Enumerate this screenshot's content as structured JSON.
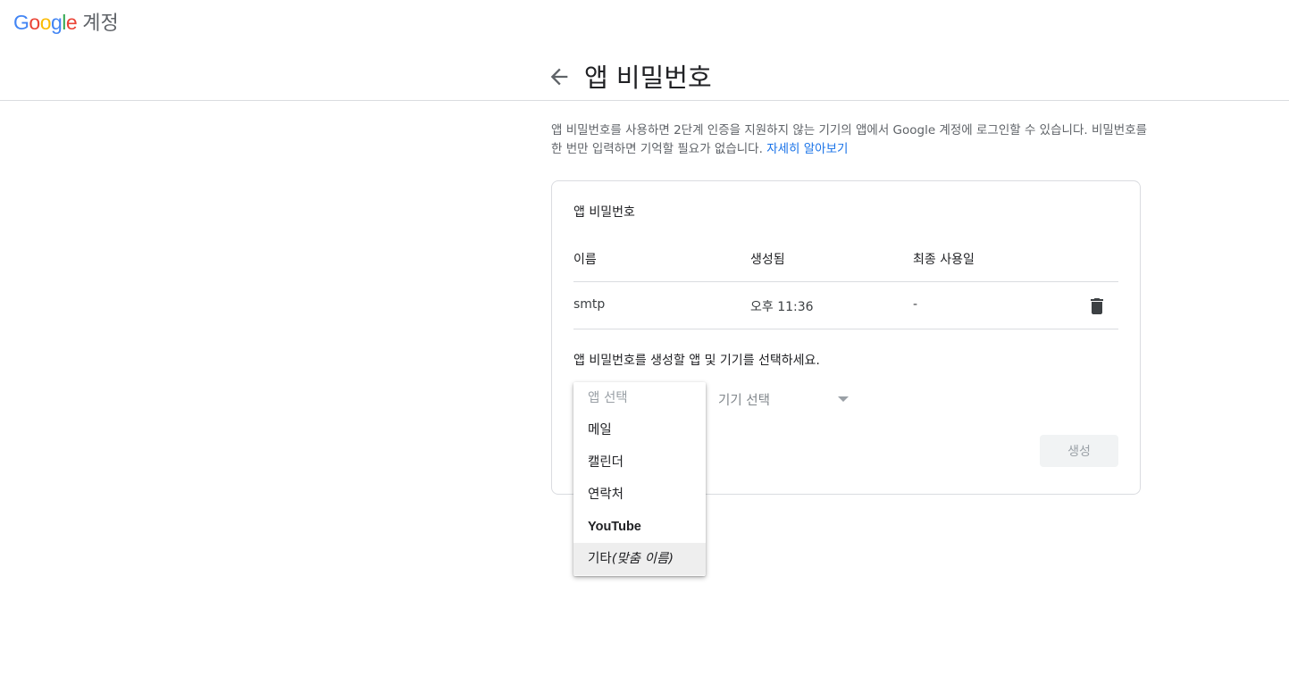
{
  "brand": {
    "logo_letters": [
      {
        "ch": "G",
        "color": "#4285F4"
      },
      {
        "ch": "o",
        "color": "#EA4335"
      },
      {
        "ch": "o",
        "color": "#FBBC05"
      },
      {
        "ch": "g",
        "color": "#4285F4"
      },
      {
        "ch": "l",
        "color": "#34A853"
      },
      {
        "ch": "e",
        "color": "#EA4335"
      }
    ],
    "logo_text": "Google",
    "suffix": "계정"
  },
  "header": {
    "back_icon": "arrow-back-icon",
    "title": "앱 비밀번호"
  },
  "intro": {
    "text": "앱 비밀번호를 사용하면 2단계 인증을 지원하지 않는 기기의 앱에서 Google 계정에 로그인할 수 있습니다. 비밀번호를 한 번만 입력하면 기억할 필요가 없습니다.",
    "link": "자세히 알아보기"
  },
  "card": {
    "title": "앱 비밀번호",
    "columns": [
      "이름",
      "생성됨",
      "최종 사용일"
    ],
    "rows": [
      {
        "name": "smtp",
        "created": "오후 11:36",
        "last_used": "-",
        "delete_icon": "trash-icon"
      }
    ],
    "instruction": "앱 비밀번호를 생성할 앱 및 기기를 선택하세요.",
    "device_select": {
      "placeholder": "기기 선택"
    },
    "generate_label": "생성"
  },
  "app_dropdown": {
    "placeholder": "앱 선택",
    "options": [
      "메일",
      "캘린더",
      "연락처",
      "YouTube"
    ],
    "custom_option": {
      "prefix": "기타",
      "suffix": "(맞춤 이름)"
    }
  },
  "colors": {
    "link": "#1a73e8",
    "divider": "#dadce0",
    "muted_text": "#5f6368"
  }
}
